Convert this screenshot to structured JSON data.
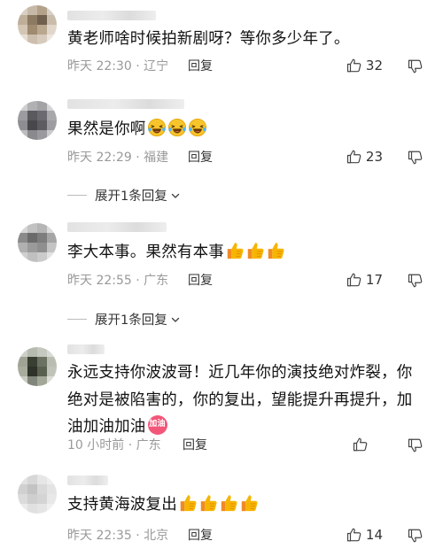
{
  "comments": [
    {
      "text": "黄老师啥时候拍新剧呀？等你多少年了。",
      "time": "昨天 22:30",
      "location": "辽宁",
      "reply_label": "回复",
      "likes": "32",
      "emojis": []
    },
    {
      "text": "果然是你啊",
      "time": "昨天 22:29",
      "location": "福建",
      "reply_label": "回复",
      "likes": "23",
      "emojis": [
        "laughing-crying-emoji",
        "laughing-crying-emoji",
        "laughing-crying-emoji"
      ],
      "expand_label": "展开1条回复"
    },
    {
      "text": "李大本事。果然有本事",
      "time": "昨天 22:55",
      "location": "广东",
      "reply_label": "回复",
      "likes": "17",
      "emojis": [
        "thumbs-up-emoji",
        "thumbs-up-emoji",
        "thumbs-up-emoji"
      ],
      "expand_label": "展开1条回复"
    },
    {
      "text_lines": [
        "永远支持你波波哥！近几年你的演技绝对炸裂，你",
        "绝对是被陷害的，你的复出，望能提升再提升，加",
        "油加油加油"
      ],
      "time": "10 小时前",
      "location": "广东",
      "reply_label": "回复",
      "likes": "",
      "emojis": [
        "jiayou-sticker-emoji"
      ],
      "sticker_text": "加油"
    },
    {
      "text": "支持黄海波复出",
      "time": "昨天 22:35",
      "location": "北京",
      "reply_label": "回复",
      "likes": "14",
      "emojis": [
        "thumbs-up-emoji",
        "thumbs-up-emoji",
        "thumbs-up-emoji",
        "thumbs-up-emoji"
      ]
    }
  ],
  "colors": {
    "text": "#111111",
    "meta": "#999999",
    "action": "#333333",
    "emoji_yellow": "#f7b500",
    "emoji_orange": "#f08a24",
    "sticker_pink": "#f2577a"
  }
}
